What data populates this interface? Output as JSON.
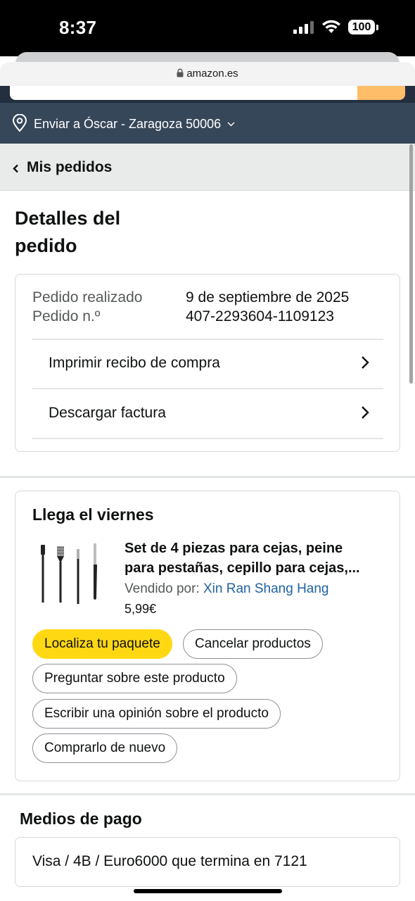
{
  "status_bar": {
    "time": "8:37",
    "battery": "100"
  },
  "browser": {
    "url": "amazon.es"
  },
  "delivery": {
    "text": "Enviar a Óscar - Zaragoza 50006"
  },
  "nav": {
    "back_label": "Mis pedidos"
  },
  "page": {
    "title_line1": "Detalles del",
    "title_line2": "pedido"
  },
  "order_summary": {
    "placed_label": "Pedido realizado",
    "placed_value": "9 de septiembre de 2025",
    "number_label": "Pedido n.º",
    "number_value": "407-2293604-1109123",
    "print_label": "Imprimir recibo de compra",
    "invoice_label": "Descargar factura"
  },
  "shipment": {
    "arrival": "Llega el viernes",
    "product_title_line1": "Set de 4 piezas para cejas, peine",
    "product_title_line2": "para pestañas, cepillo para cejas,...",
    "seller_label": "Vendido por:",
    "seller_name": "Xin Ran Shang Hang",
    "price": "5,99€",
    "buttons": {
      "track": "Localiza tu paquete",
      "cancel": "Cancelar productos",
      "ask": "Preguntar sobre este producto",
      "review": "Escribir una opinión sobre el producto",
      "buy_again": "Comprarlo de nuevo"
    }
  },
  "payment": {
    "title": "Medios de pago",
    "method": "Visa / 4B / Euro6000  que termina en 7121"
  },
  "colors": {
    "primary_button": "#ffd814",
    "header_dark": "#232f3e",
    "deliver_bar": "#37475a",
    "search_button": "#febd69",
    "link": "#2162a1"
  }
}
